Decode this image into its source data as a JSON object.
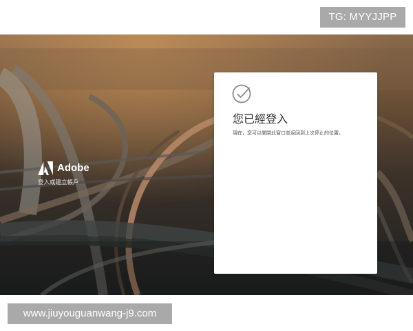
{
  "watermark": {
    "tg_label": "TG: MYYJJPP",
    "url_label": "www.jiuyouguanwang-j9.com"
  },
  "brand": {
    "name": "Adobe",
    "tagline": "登入或建立帳戶",
    "logo_icon": "adobe-logo-icon"
  },
  "card": {
    "icon": "check-circle-icon",
    "title": "您已經登入",
    "message": "現在，您可以關閉此窗口並返回到上次停止的位置。"
  },
  "colors": {
    "badge_gray": "#a9a9a9",
    "card_bg": "#ffffff",
    "title_text": "#2c2c2c"
  }
}
